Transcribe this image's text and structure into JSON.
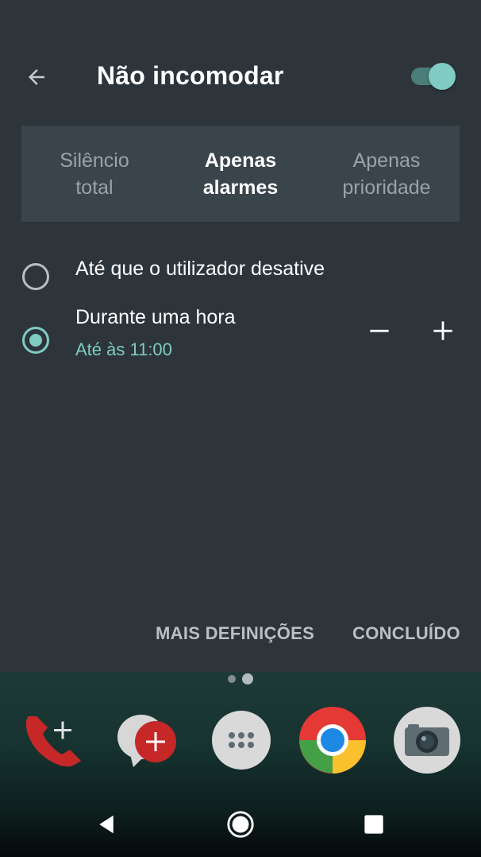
{
  "header": {
    "title": "Não incomodar",
    "back_icon": "arrow-back-icon",
    "toggle_on": true
  },
  "modes": [
    {
      "label": "Silêncio\ntotal",
      "active": false
    },
    {
      "label": "Apenas\nalarmes",
      "active": true
    },
    {
      "label": "Apenas\nprioridade",
      "active": false
    }
  ],
  "options": {
    "until_off": {
      "label": "Até que o utilizador desative",
      "checked": false
    },
    "one_hour": {
      "label": "Durante uma hora",
      "sublabel": "Até às 11:00",
      "checked": true
    }
  },
  "actions": {
    "more_settings": "MAIS DEFINIÇÕES",
    "done": "CONCLUÍDO"
  },
  "dock": {
    "apps": [
      "phone-icon",
      "messages-icon",
      "app-drawer-icon",
      "chrome-icon",
      "camera-icon"
    ]
  },
  "navbar": {
    "buttons": [
      "back-icon",
      "home-icon",
      "recents-icon"
    ]
  },
  "colors": {
    "accent": "#80cbc4",
    "panel_bg": "#2d353b",
    "segment_bg": "#3a444b"
  }
}
